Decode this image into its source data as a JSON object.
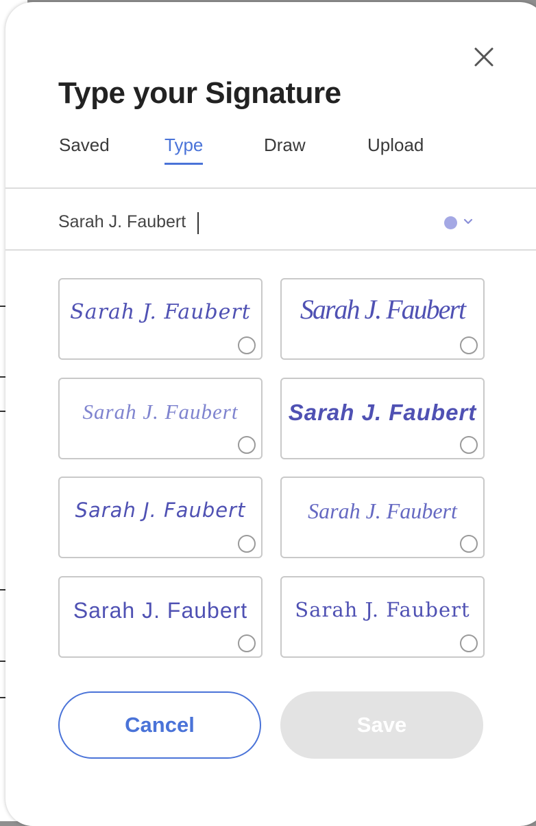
{
  "dialog": {
    "title": "Type your Signature",
    "close_icon": "close-icon"
  },
  "tabs": [
    {
      "label": "Saved",
      "active": false
    },
    {
      "label": "Type",
      "active": true
    },
    {
      "label": "Draw",
      "active": false
    },
    {
      "label": "Upload",
      "active": false
    }
  ],
  "name_input": {
    "value": "Sarah J. Faubert"
  },
  "color_picker": {
    "selected_color": "#a4a8e4",
    "icon": "chevron-down-icon"
  },
  "signature_options": [
    {
      "text": "Sarah J. Faubert",
      "selected": false
    },
    {
      "text": "Sarah J. Faubert",
      "selected": false
    },
    {
      "text": "Sarah J. Faubert",
      "selected": false
    },
    {
      "text": "Sarah J. Faubert",
      "selected": false
    },
    {
      "text": "Sarah J. Faubert",
      "selected": false
    },
    {
      "text": "Sarah J. Faubert",
      "selected": false
    },
    {
      "text": "Sarah J. Faubert",
      "selected": false
    },
    {
      "text": "Sarah J. Faubert",
      "selected": false
    }
  ],
  "buttons": {
    "cancel_label": "Cancel",
    "save_label": "Save",
    "save_enabled": false
  },
  "colors": {
    "accent": "#4a73d8",
    "signature_ink": "#4f51b3",
    "disabled_button": "#e3e3e3"
  }
}
